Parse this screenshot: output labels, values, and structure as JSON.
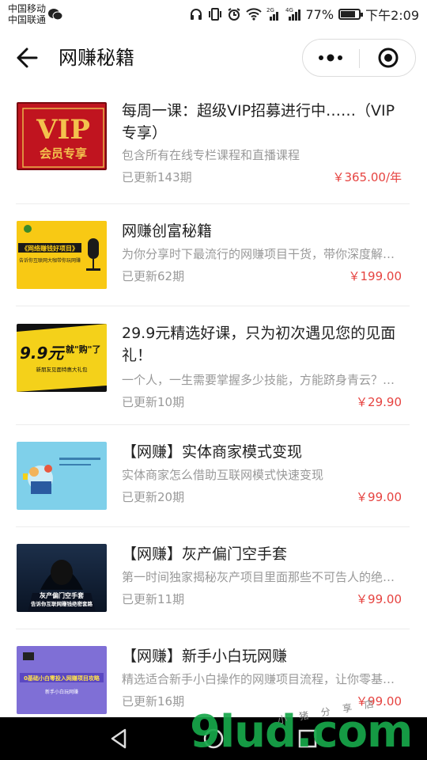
{
  "status_bar": {
    "carrier_1": "中国移动",
    "carrier_2": "中国联通",
    "battery": "77%",
    "time": "下午2:09",
    "icons": [
      "wechat-icon",
      "headset-icon",
      "vibrate-icon",
      "alarm-icon",
      "wifi-icon",
      "signal-2g-icon",
      "signal-4g-icon",
      "battery-icon"
    ]
  },
  "navbar": {
    "title": "网赚秘籍",
    "icons": [
      "back-arrow-icon",
      "more-dots-icon",
      "close-circle-icon"
    ]
  },
  "items": [
    {
      "title": "每周一课：超级VIP招募进行中……（VIP专享）",
      "desc": "包含所有在线专栏课程和直播课程",
      "updates": "已更新143期",
      "price": "￥365.00/年",
      "thumb_text": [
        "VIP",
        "会员专享"
      ]
    },
    {
      "title": "网赚创富秘籍",
      "desc": "为你分享时下最流行的网赚项目干货，带你深度解析网赚项目",
      "updates": "已更新62期",
      "price": "￥199.00",
      "thumb_text": [
        "《网络赚钱好项目》",
        "告诉你互联网大咖带你玩网赚"
      ]
    },
    {
      "title": "29.9元精选好课，只为初次遇见您的见面礼！",
      "desc": "一个人，一生需要掌握多少技能，方能跻身青云？一个人",
      "updates": "已更新10期",
      "price": "￥29.90",
      "thumb_text": [
        "9.9元",
        "就\"购\"了",
        "新朋友见面特惠大礼包"
      ]
    },
    {
      "title": "【网赚】实体商家模式变现",
      "desc": "实体商家怎么借助互联网模式快速变现",
      "updates": "已更新20期",
      "price": "￥99.00",
      "thumb_text": []
    },
    {
      "title": "【网赚】灰产偏门空手套",
      "desc": "第一时间独家揭秘灰产项目里面那些不可告人的绝密套路",
      "updates": "已更新11期",
      "price": "￥99.00",
      "thumb_text": [
        "灰产偏门空手套",
        "告诉你互联网赚钱绝密套路"
      ]
    },
    {
      "title": "【网赚】新手小白玩网赚",
      "desc": "精选适合新手小白操作的网赚项目流程，让你零基础也能赚钱",
      "updates": "已更新16期",
      "price": "￥99.00",
      "thumb_text": [
        "0基础小白零投入网赚项目攻略",
        "新手小白玩网赚"
      ]
    }
  ],
  "watermark": {
    "text": "9lud.com",
    "small": "小 猪 分 享 店"
  },
  "system_nav": {
    "icons": [
      "back-triangle-icon",
      "home-circle-icon",
      "recents-square-icon"
    ]
  },
  "colors": {
    "price": "#e64340",
    "secondary_text": "#999999",
    "watermark_green": "#17a84a",
    "watermark_orange": "#f28c1b"
  }
}
